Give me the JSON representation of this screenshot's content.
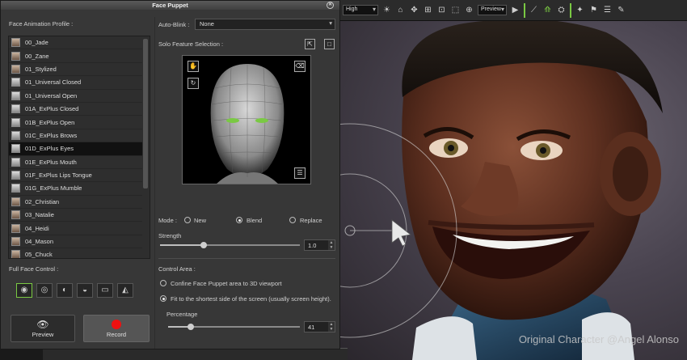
{
  "panel": {
    "title": "Face Puppet",
    "profile_label": "Face Animation Profile :",
    "profiles": [
      {
        "label": "00_Jade",
        "thumb": "face"
      },
      {
        "label": "00_Zane",
        "thumb": "face"
      },
      {
        "label": "01_Stylized",
        "thumb": "face"
      },
      {
        "label": "01_Universal Closed",
        "thumb": "mask"
      },
      {
        "label": "01_Universal Open",
        "thumb": "mask"
      },
      {
        "label": "01A_ExPlus Closed",
        "thumb": "mask"
      },
      {
        "label": "01B_ExPlus Open",
        "thumb": "mask"
      },
      {
        "label": "01C_ExPlus Brows",
        "thumb": "mask"
      },
      {
        "label": "01D_ExPlus Eyes",
        "thumb": "mask"
      },
      {
        "label": "01E_ExPlus Mouth",
        "thumb": "mask"
      },
      {
        "label": "01F_ExPlus Lips Tongue",
        "thumb": "mask"
      },
      {
        "label": "01G_ExPlus Mumble",
        "thumb": "mask"
      },
      {
        "label": "02_Christian",
        "thumb": "face"
      },
      {
        "label": "03_Natalie",
        "thumb": "face"
      },
      {
        "label": "04_Heidi",
        "thumb": "face"
      },
      {
        "label": "04_Mason",
        "thumb": "face"
      },
      {
        "label": "05_Chuck",
        "thumb": "face"
      }
    ],
    "selected_profile": "01D_ExPlus Eyes",
    "full_face_label": "Full Face Control :",
    "preview_label": "Preview",
    "record_label": "Record",
    "autoblink_label": "Auto-Blink :",
    "autoblink_value": "None",
    "solo_label": "Solo Feature Selection :",
    "mode_label": "Mode :",
    "mode_new": "New",
    "mode_blend": "Blend",
    "mode_replace": "Replace",
    "mode_selected": "Blend",
    "strength_label": "Strength",
    "strength_value": "1.0",
    "control_area_label": "Control Area :",
    "option_confine": "Confine Face Puppet area to 3D viewport",
    "option_fit": "Fit to the shortest side of the screen (usually screen height).",
    "option_selected": "fit",
    "percentage_label": "Percentage",
    "percentage_value": "41",
    "strength_fraction": 0.31,
    "percentage_fraction": 0.17
  },
  "viewport": {
    "quality_value": "High",
    "render_value": "Preview",
    "credit": "Original Character @Angel Alonso"
  },
  "colors": {
    "accent": "#7ac943",
    "record": "#e11111"
  }
}
